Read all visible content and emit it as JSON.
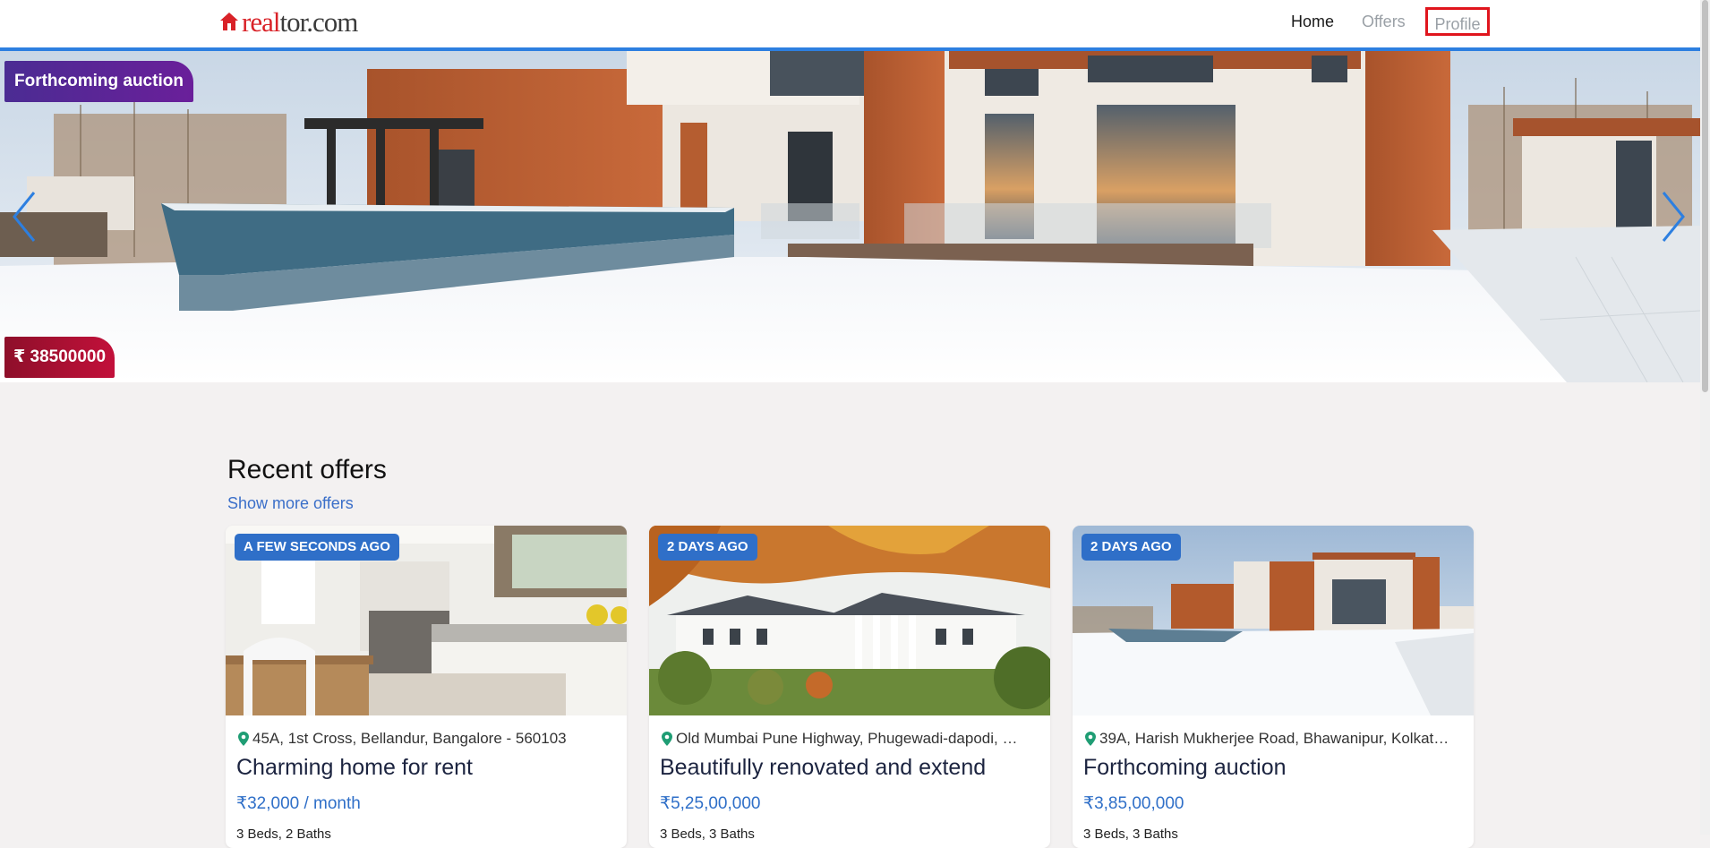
{
  "nav": {
    "logo_real": "real",
    "logo_rest": "tor.com",
    "home": "Home",
    "offers": "Offers",
    "profile": "Profile"
  },
  "hero": {
    "badge": "Forthcoming auction",
    "price": "₹ 38500000"
  },
  "recent": {
    "title": "Recent offers",
    "show_more": "Show more offers"
  },
  "cards": [
    {
      "time": "A few seconds ago",
      "address": "45A, 1st Cross, Bellandur, Bangalore - 560103",
      "title": "Charming home for rent",
      "price": "₹32,000 / month",
      "meta": "3 Beds, 2 Baths"
    },
    {
      "time": "2 days ago",
      "address": "Old Mumbai Pune Highway, Phugewadi-dapodi, …",
      "title": "Beautifully renovated and extend",
      "price": "₹5,25,00,000",
      "meta": "3 Beds, 3 Baths"
    },
    {
      "time": "2 days ago",
      "address": "39A, Harish Mukherjee Road, Bhawanipur, Kolkat…",
      "title": "Forthcoming auction",
      "price": "₹3,85,00,000",
      "meta": "3 Beds, 3 Baths"
    }
  ],
  "colors": {
    "accent": "#2d7fe0",
    "brand_red": "#d92228",
    "badge_blue": "#2f6fc8",
    "auction_purple": "#4b2c93",
    "price_crimson": "#c2103a"
  },
  "icons": [
    "house-logo-icon",
    "chevron-left-icon",
    "chevron-right-icon",
    "map-pin-icon"
  ]
}
